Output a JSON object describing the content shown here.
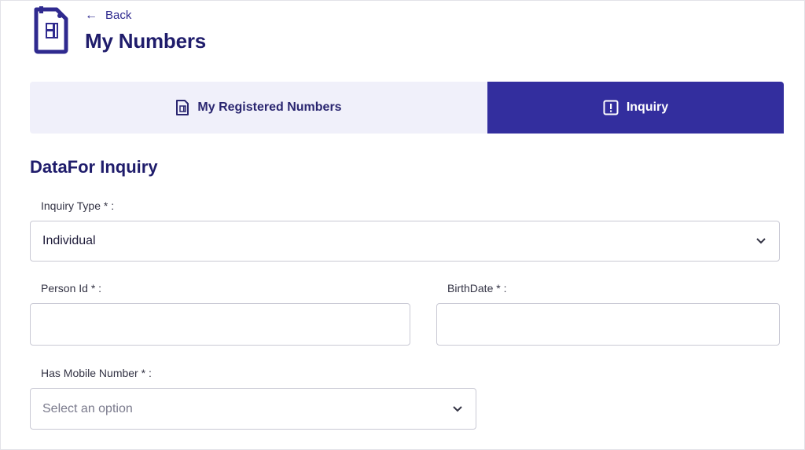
{
  "header": {
    "back_label": "Back",
    "title": "My Numbers",
    "icon": "sim-card-icon"
  },
  "tabs": [
    {
      "label": "My Registered Numbers",
      "icon": "sim-document-icon",
      "active": false
    },
    {
      "label": "Inquiry",
      "icon": "exclamation-box-icon",
      "active": true
    }
  ],
  "form": {
    "section_title": "DataFor Inquiry",
    "inquiry_type": {
      "label": "Inquiry Type * :",
      "value": "Individual"
    },
    "person_id": {
      "label": "Person Id * :",
      "value": ""
    },
    "birth_date": {
      "label": "BirthDate * :",
      "value": ""
    },
    "has_mobile": {
      "label": "Has Mobile Number * :",
      "placeholder": "Select an option"
    }
  },
  "colors": {
    "brand": "#332e9e",
    "title": "#1f1c6b",
    "tab_inactive_bg": "#f0f0fa"
  }
}
